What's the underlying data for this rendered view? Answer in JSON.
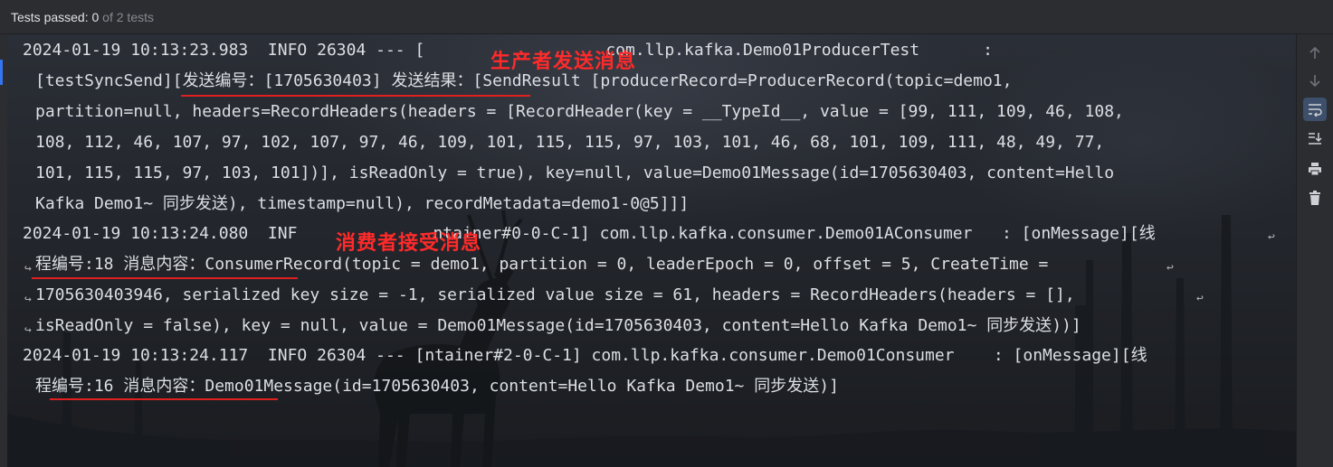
{
  "status": {
    "passed_label": "Tests passed: ",
    "passed_count": "0",
    "of_text": " of 2 tests"
  },
  "annotations": {
    "producer": "生产者发送消息",
    "consumer": "消费者接受消息"
  },
  "log": {
    "l1": {
      "a": "2024-01-19 10:13:23.983  INFO 26304 --- [",
      "b": "com.llp.kafka.Demo01ProducerTest",
      "c": ":"
    },
    "l2": {
      "a": "[testSyncSend][",
      "b": "发送编号：",
      "c": "[1705630403] ",
      "d": "发送结果：",
      "e": "[SendResult [producerRecord=ProducerRecord(topic=demo1,"
    },
    "l3": "partition=null, headers=RecordHeaders(headers = [RecordHeader(key = __TypeId__, value = [99, 111, 109, 46, 108,",
    "l4": "108, 112, 46, 107, 97, 102, 107, 97, 46, 109, 101, 115, 115, 97, 103, 101, 46, 68, 101, 109, 111, 48, 49, 77,",
    "l5": "101, 115, 115, 97, 103, 101])], isReadOnly = true), key=null, value=Demo01Message(id=1705630403, content=Hello",
    "l6": {
      "a": "Kafka Demo1~ ",
      "b": "同步发送",
      "c": "), timestamp=null), recordMetadata=demo1-0@5]]]"
    },
    "l7": {
      "a": "2024-01-19 10:13:24.080  INF",
      "b": "ntainer#0-0-C-1] com.llp.kafka.consumer.Demo01AConsumer   : [onMessage][",
      "c": "线"
    },
    "l8": {
      "a": "程编号",
      "b": ":18 ",
      "c": "消息内容：",
      "d": "ConsumerRecord(topic = demo1, partition = 0, leaderEpoch = 0, offset = 5, CreateTime = "
    },
    "l9": "1705630403946, serialized key size = -1, serialized value size = 61, headers = RecordHeaders(headers = [], ",
    "l10": {
      "a": "isReadOnly = false), key = null, value = Demo01Message(id=1705630403, content=Hello Kafka Demo1~ ",
      "b": "同步发送",
      "c": "))]"
    },
    "l11": {
      "a": "2024-01-19 10:13:24.117  INFO 26304 --- [ntainer#2-0-C-1] com.llp.kafka.consumer.Demo01Consumer    : [onMessage][",
      "b": "线"
    },
    "l12": {
      "a": "程编号",
      "b": ":16 ",
      "c": "消息内容：",
      "d": "Demo01Message(id=1705630403, content=Hello Kafka Demo1~ ",
      "e": "同步发送",
      "f": ")]"
    }
  },
  "toolbar": {
    "up": "arrow-up-icon",
    "down": "arrow-down-icon",
    "softwrap": "soft-wrap-icon",
    "scroll_end": "scroll-to-end-icon",
    "print": "print-icon",
    "clear": "trash-icon"
  },
  "colors": {
    "annotation": "#ff2a2a",
    "underline": "#e02020",
    "text": "#dcdfe4",
    "toolbar_bg": "#2b2d30",
    "active": "#3d4f6a"
  }
}
